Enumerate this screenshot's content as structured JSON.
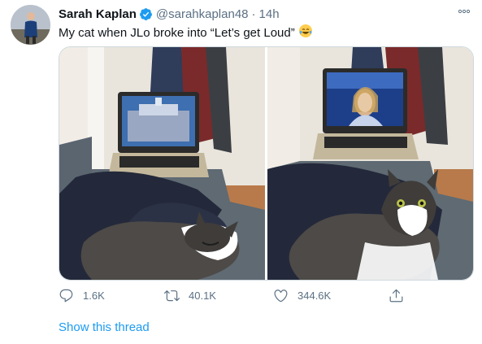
{
  "tweet": {
    "author_name": "Sarah Kaplan",
    "handle": "@sarahkaplan48",
    "separator": "·",
    "timestamp": "14h",
    "more_icon": "more-horizontal-icon",
    "verified_icon": "verified-badge-icon",
    "text": "My cat when JLo broke into “Let’s get Loud”",
    "emoji": "😂"
  },
  "media": {
    "left_photo": "cat-asleep-laptop-photo",
    "right_photo": "cat-alert-laptop-photo"
  },
  "actions": {
    "reply_count": "1.6K",
    "retweet_count": "40.1K",
    "like_count": "344.6K",
    "icons": [
      "reply-icon",
      "retweet-icon",
      "like-icon",
      "share-icon"
    ]
  },
  "show_thread": "Show this thread",
  "colors": {
    "accent": "#1d9bf0",
    "secondary_text": "#5b7083",
    "border": "#cfd9de"
  }
}
